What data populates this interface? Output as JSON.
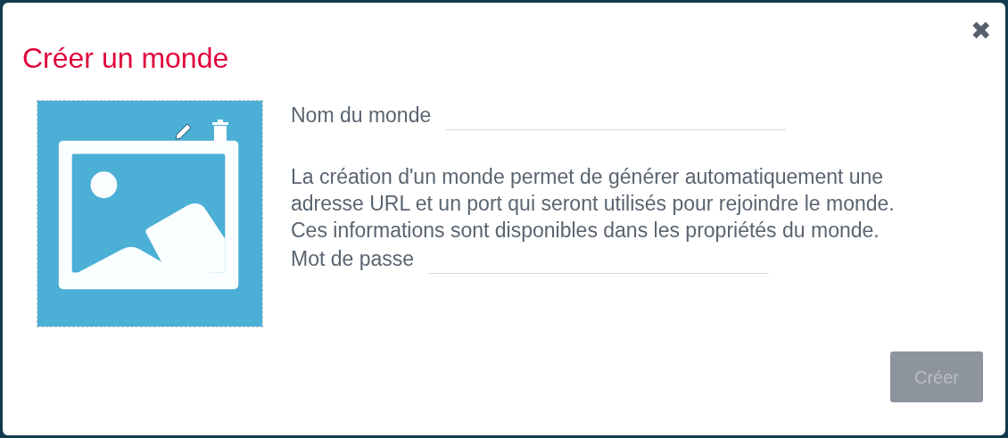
{
  "dialog": {
    "title": "Créer un monde",
    "close_icon": "✖",
    "fields": [
      {
        "label": "Nom du monde"
      },
      {
        "label": "Mot de passe"
      }
    ],
    "description": "La création d'un monde permet de générer automatiquement une adresse URL et un port qui seront utilisés pour rejoindre le monde. Ces informations sont disponibles dans les propriétés du monde.",
    "create_button": {
      "label": "Créer",
      "disabled": true
    }
  }
}
